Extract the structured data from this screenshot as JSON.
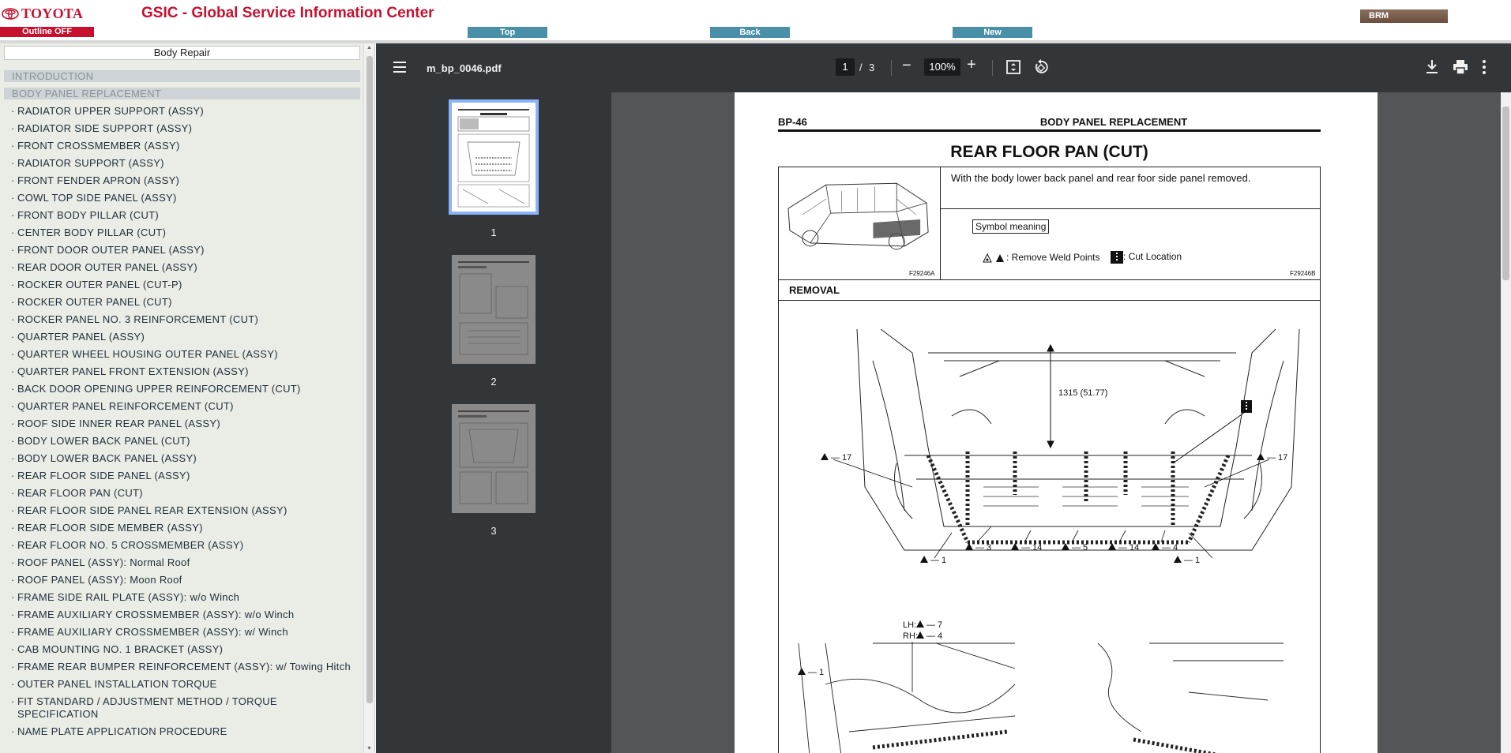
{
  "header": {
    "logo_text": "TOYOTA",
    "outline_button": "Outline OFF",
    "app_title": "GSIC - Global Service Information Center",
    "nav": {
      "top": "Top",
      "back": "Back",
      "new": "New"
    },
    "brm_button": "BRM"
  },
  "sidebar": {
    "title": "Body Repair",
    "sections": [
      "INTRODUCTION",
      "BODY PANEL REPLACEMENT"
    ],
    "items": [
      "RADIATOR UPPER SUPPORT (ASSY)",
      "RADIATOR SIDE SUPPORT (ASSY)",
      "FRONT CROSSMEMBER (ASSY)",
      "RADIATOR SUPPORT (ASSY)",
      "FRONT FENDER APRON (ASSY)",
      "COWL TOP SIDE PANEL (ASSY)",
      "FRONT BODY PILLAR (CUT)",
      "CENTER BODY PILLAR (CUT)",
      "FRONT DOOR OUTER PANEL (ASSY)",
      "REAR DOOR OUTER PANEL (ASSY)",
      "ROCKER OUTER PANEL (CUT-P)",
      "ROCKER OUTER PANEL (CUT)",
      "ROCKER PANEL NO. 3 REINFORCEMENT (CUT)",
      "QUARTER PANEL (ASSY)",
      "QUARTER WHEEL HOUSING OUTER PANEL (ASSY)",
      "QUARTER PANEL FRONT EXTENSION (ASSY)",
      "BACK DOOR OPENING UPPER REINFORCEMENT (CUT)",
      "QUARTER PANEL REINFORCEMENT (CUT)",
      "ROOF SIDE INNER REAR PANEL (ASSY)",
      "BODY LOWER BACK PANEL (CUT)",
      "BODY LOWER BACK PANEL (ASSY)",
      "REAR FLOOR SIDE PANEL (ASSY)",
      "REAR FLOOR PAN (CUT)",
      "REAR FLOOR SIDE PANEL REAR EXTENSION (ASSY)",
      "REAR FLOOR SIDE MEMBER (ASSY)",
      "REAR FLOOR NO. 5 CROSSMEMBER (ASSY)",
      "ROOF PANEL (ASSY): Normal Roof",
      "ROOF PANEL (ASSY): Moon Roof",
      "FRAME SIDE RAIL PLATE (ASSY): w/o Winch",
      "FRAME AUXILIARY CROSSMEMBER (ASSY): w/o Winch",
      "FRAME AUXILIARY CROSSMEMBER (ASSY): w/ Winch",
      "CAB MOUNTING NO. 1 BRACKET (ASSY)",
      "FRAME REAR BUMPER REINFORCEMENT (ASSY): w/ Towing Hitch",
      "OUTER PANEL INSTALLATION TORQUE",
      "FIT STANDARD / ADJUSTMENT METHOD / TORQUE SPECIFICATION",
      "NAME PLATE APPLICATION PROCEDURE"
    ]
  },
  "viewer": {
    "file_name": "m_bp_0046.pdf",
    "current_page": "1",
    "page_sep": "/",
    "total_pages": "3",
    "zoom": "100%",
    "thumbnails": [
      "1",
      "2",
      "3"
    ],
    "icons": [
      "menu-icon",
      "zoom-out-icon",
      "zoom-in-icon",
      "fit-page-icon",
      "rotate-icon",
      "download-icon",
      "print-icon",
      "more-icon"
    ]
  },
  "document": {
    "code": "BP-46",
    "section": "BODY PANEL REPLACEMENT",
    "title": "REAR FLOOR PAN (CUT)",
    "description": "With the body lower back panel and rear foor side panel removed.",
    "symbol_meaning": "Symbol meaning",
    "weld_legend": ": Remove Weld Points",
    "cut_legend": ": Cut Location",
    "image_code_a": "F29246A",
    "image_code_b": "F29246B",
    "removal": "REMOVAL",
    "dimension": "1315 (51.77)",
    "weld_counts": {
      "left_side": "— 17",
      "right_side": "— 17",
      "front_left": "— 1",
      "front_right": "— 1",
      "c3": "— 3",
      "c14a": "— 14",
      "c5": "— 5",
      "c14b": "— 14",
      "c4": "— 4",
      "lh_label": "LH:",
      "lh_count": "— 7",
      "rh_label": "RH:",
      "rh_count": "— 4",
      "bottom_left": "— 1"
    }
  }
}
